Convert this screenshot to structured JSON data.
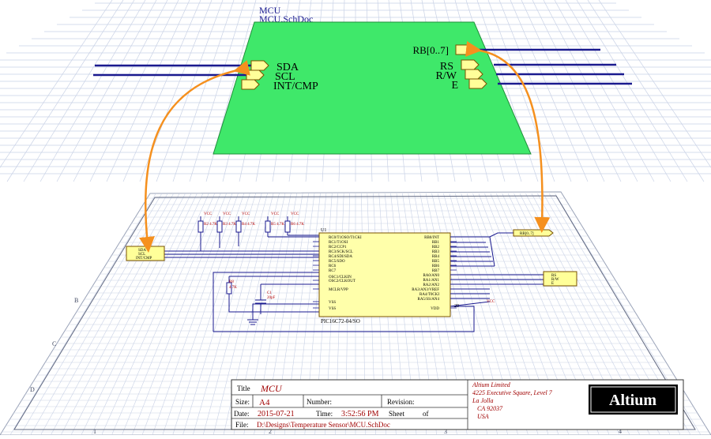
{
  "colors": {
    "sheet_fill": "#3fe86a",
    "port_fill": "#ffff99",
    "port_stroke": "#7a5200",
    "wire": "#1a1a8f",
    "grid": "#c9d2e6",
    "arrow": "#f5901e",
    "ic_fill": "#ffffaa",
    "red_text": "#b40000",
    "title_red": "#a00000"
  },
  "top_sheet": {
    "designator": "MCU",
    "filename": "MCU.SchDoc",
    "left_ports": [
      "SDA",
      "SCL",
      "INT/CMP"
    ],
    "right_ports": [
      "RB[0..7]",
      "RS",
      "R/W",
      "E"
    ]
  },
  "schematic": {
    "chip_designator": "U1",
    "chip_name": "PIC16C72-04/SO",
    "left_pins": [
      "RC0/T1OSO/T1CKI",
      "RC1/T1OSI",
      "RC2/CCP1",
      "RC3/SCK/SCL",
      "RC4/SDI/SDA",
      "RC5/SDO",
      "RC6",
      "RC7",
      "OSC1/CLKIN",
      "OSC2/CLKOUT",
      "MCLR/VPP",
      "VSS",
      "VSS"
    ],
    "right_pins": [
      "RB0/INT",
      "RB1",
      "RB2",
      "RB3",
      "RB4",
      "RB5",
      "RB6",
      "RB7",
      "RA0/AN0",
      "RA1/AN1",
      "RA2/AN2",
      "RA3/AN3/VREF",
      "RA4/T0CKI",
      "RA5/SS/AN4",
      "VDD"
    ],
    "left_ports": [
      "SDA",
      "SCL",
      "INT/CMP"
    ],
    "right_ports": [
      "RB[0..7]",
      "RS",
      "R/W",
      "E"
    ],
    "resistors": [
      "R2 4.7K",
      "R3 4.7K",
      "R4 4.7K",
      "R5 4.7K",
      "R6 4.7K"
    ],
    "r8": "R8",
    "r8_value": "4.7K",
    "cap": "C1",
    "cap_value": "20pF",
    "vcc_label": "VCC",
    "pin20": "20"
  },
  "title_block": {
    "title_label": "Title",
    "title_value": "MCU",
    "size_label": "Size:",
    "size_value": "A4",
    "number_label": "Number:",
    "revision_label": "Revision:",
    "date_label": "Date:",
    "date_value": "2015-07-21",
    "time_label": "Time:",
    "time_value": "3:52:56 PM",
    "sheet_label": "Sheet",
    "of_label": "of",
    "file_label": "File:",
    "file_value": "D:\\Designs\\Temperature Sensor\\MCU.SchDoc",
    "company_lines": [
      "Altium Limited",
      "4225 Executive Square, Level 7",
      "La Jolla",
      "CA 92037",
      "USA"
    ],
    "logo_text": "Altium"
  },
  "border_zones": {
    "numbers": [
      "1",
      "2",
      "3",
      "4"
    ],
    "letters": [
      "B",
      "C",
      "D"
    ]
  }
}
